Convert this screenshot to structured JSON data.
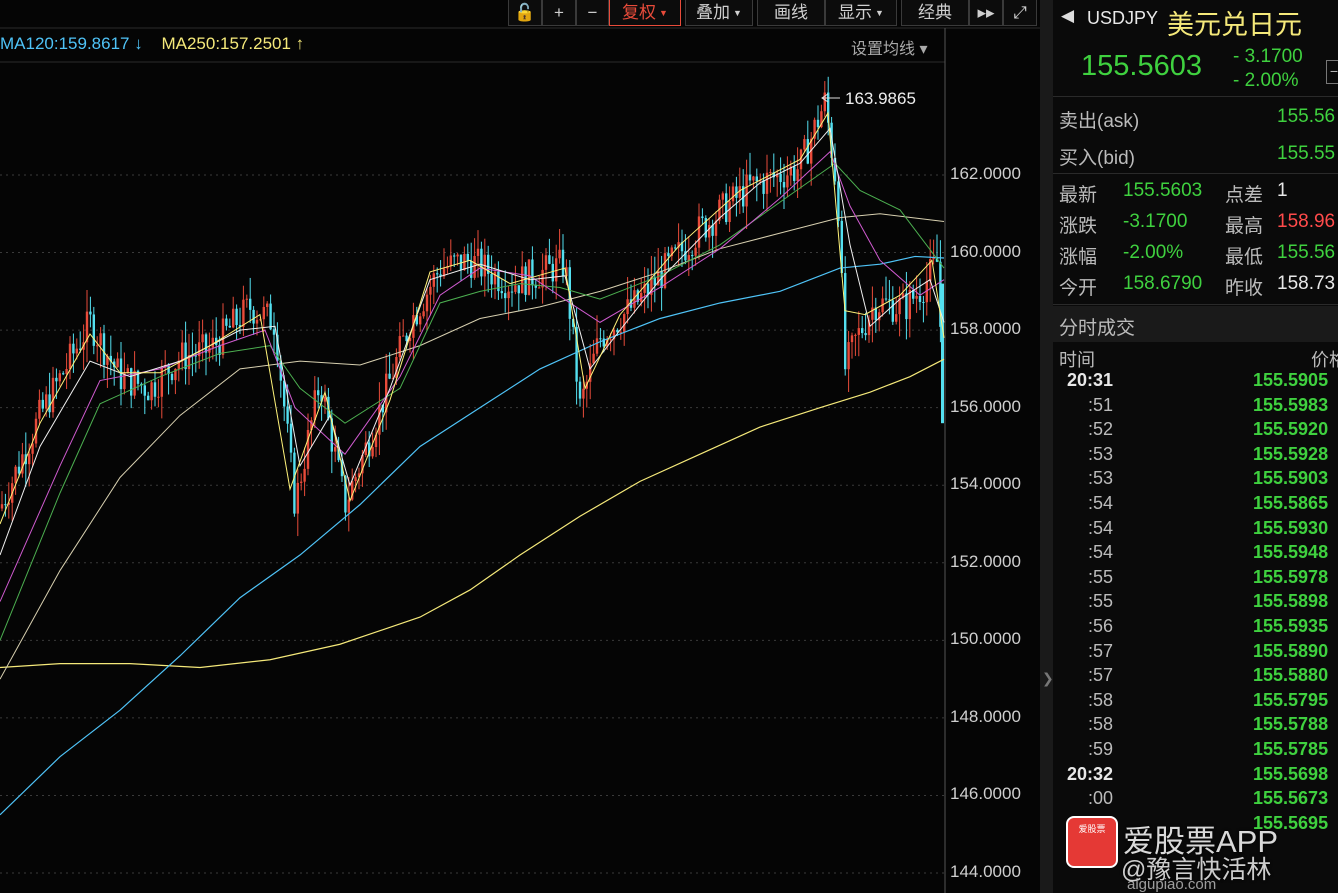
{
  "toolbar": {
    "buttons": [
      {
        "label": "🔓",
        "name": "lock-icon"
      },
      {
        "label": "+",
        "name": "zoom-in-button"
      },
      {
        "label": "−",
        "name": "zoom-out-button"
      },
      {
        "label": "复权",
        "name": "adjust-button",
        "dropdown": true,
        "active": true
      },
      {
        "label": "叠加",
        "name": "overlay-button",
        "dropdown": true
      },
      {
        "label": "画线",
        "name": "draw-line-button"
      },
      {
        "label": "显示",
        "name": "display-button",
        "dropdown": true
      },
      {
        "label": "经典",
        "name": "classic-button"
      },
      {
        "label": "▸▸",
        "name": "fast-forward-icon"
      },
      {
        "label": "⤢",
        "name": "fullscreen-icon"
      }
    ]
  },
  "ma_legend": {
    "ma120": "MA120:159.8617 ↓",
    "ma250": "MA250:157.2501 ↑",
    "ma120_color": "#4fc3f7",
    "ma250_color": "#f5e97a",
    "settings_label": "设置均线 ▾"
  },
  "chart": {
    "price_labels": [
      "162.0000",
      "160.0000",
      "158.0000",
      "156.0000",
      "154.0000",
      "152.0000",
      "150.0000",
      "148.0000",
      "146.0000",
      "144.0000"
    ],
    "high_annotation": "163.9865",
    "up_color": "#e84b3a",
    "down_color": "#54e0f0"
  },
  "chart_data": {
    "type": "line",
    "title": "",
    "y_ticks": [
      162,
      160,
      158,
      156,
      154,
      152,
      150,
      148,
      146,
      144
    ],
    "ylim": [
      144,
      164
    ],
    "annotations": [
      {
        "label": "163.9865",
        "value": 163.9865
      }
    ],
    "series": [
      {
        "name": "MA120",
        "values": [
          145.2,
          148.5,
          152.0,
          154.1,
          155.8,
          157.1,
          158.3,
          159.4,
          159.86
        ]
      },
      {
        "name": "MA250",
        "values": [
          149.3,
          149.4,
          150.3,
          152.4,
          154.2,
          155.5,
          156.5,
          157.25
        ]
      }
    ]
  },
  "quote": {
    "symbol": "USDJPY",
    "name": "美元兑日元",
    "price": "155.5603",
    "change": "- 3.1700",
    "change_pct": "- 2.00%",
    "ask_label": "卖出(ask)",
    "ask_value": "155.56",
    "bid_label": "买入(bid)",
    "bid_value": "155.55",
    "stats": [
      {
        "l1": "最新",
        "v1": "155.5603",
        "c1": "green",
        "l2": "点差",
        "v2": "1",
        "c2": "white"
      },
      {
        "l1": "涨跌",
        "v1": "-3.1700",
        "c1": "green",
        "l2": "最高",
        "v2": "158.96",
        "c2": "red"
      },
      {
        "l1": "涨幅",
        "v1": "-2.00%",
        "c1": "green",
        "l2": "最低",
        "v2": "155.56",
        "c2": "green"
      },
      {
        "l1": "今开",
        "v1": "158.6790",
        "c1": "green",
        "l2": "昨收",
        "v2": "158.73",
        "c2": "white"
      }
    ]
  },
  "trades": {
    "section_title": "分时成交",
    "col_time": "时间",
    "col_price": "价格",
    "rows": [
      {
        "time": "20:31",
        "price": "155.5905"
      },
      {
        "time": ":51",
        "price": "155.5983"
      },
      {
        "time": ":52",
        "price": "155.5920"
      },
      {
        "time": ":53",
        "price": "155.5928"
      },
      {
        "time": ":53",
        "price": "155.5903"
      },
      {
        "time": ":54",
        "price": "155.5865"
      },
      {
        "time": ":54",
        "price": "155.5930"
      },
      {
        "time": ":54",
        "price": "155.5948"
      },
      {
        "time": ":55",
        "price": "155.5978"
      },
      {
        "time": ":55",
        "price": "155.5898"
      },
      {
        "time": ":56",
        "price": "155.5935"
      },
      {
        "time": ":57",
        "price": "155.5890"
      },
      {
        "time": ":57",
        "price": "155.5880"
      },
      {
        "time": ":58",
        "price": "155.5795"
      },
      {
        "time": ":58",
        "price": "155.5788"
      },
      {
        "time": ":59",
        "price": "155.5785"
      },
      {
        "time": "20:32",
        "price": "155.5698"
      },
      {
        "time": ":00",
        "price": "155.5673"
      },
      {
        "time": "",
        "price": "155.5695"
      }
    ]
  },
  "watermark": {
    "badge": "爱股票",
    "brand": "爱股票APP",
    "handle": "@豫言快活林",
    "url": "aigupiao.com"
  }
}
